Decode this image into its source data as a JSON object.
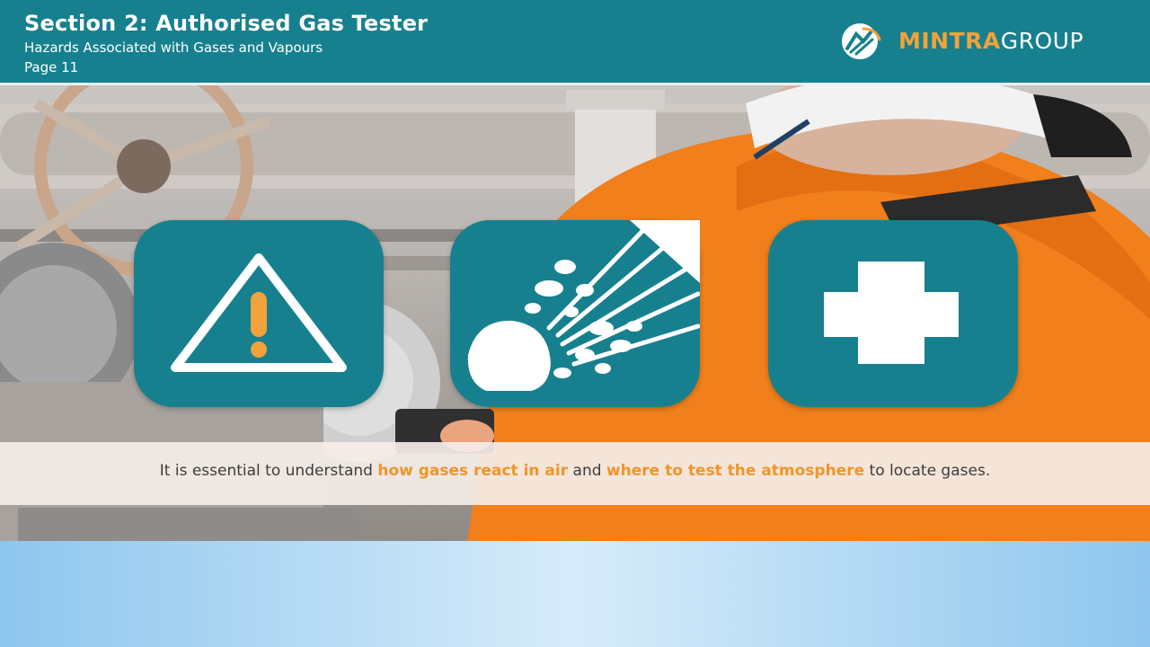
{
  "header": {
    "title": "Section 2: Authorised Gas Tester",
    "subtitle": "Hazards Associated with Gases and Vapours",
    "page": "Page 11"
  },
  "logo": {
    "icon": "mintra-logo-icon",
    "name_part1": "MINTRA",
    "name_part2": "GROUP",
    "colors": {
      "accent": "#f2a23a",
      "text": "#ffffff"
    }
  },
  "tiles": [
    {
      "icon": "warning-triangle-icon"
    },
    {
      "icon": "explosion-icon"
    },
    {
      "icon": "first-aid-cross-icon"
    }
  ],
  "caption": {
    "part1": "It is essential to understand ",
    "highlight1": "how gases react in air",
    "part2": " and ",
    "highlight2": "where to test the atmosphere",
    "part3": " to locate gases."
  },
  "colors": {
    "header_bg": "#17808f",
    "tile_bg": "#17808f",
    "highlight": "#f0952a"
  }
}
